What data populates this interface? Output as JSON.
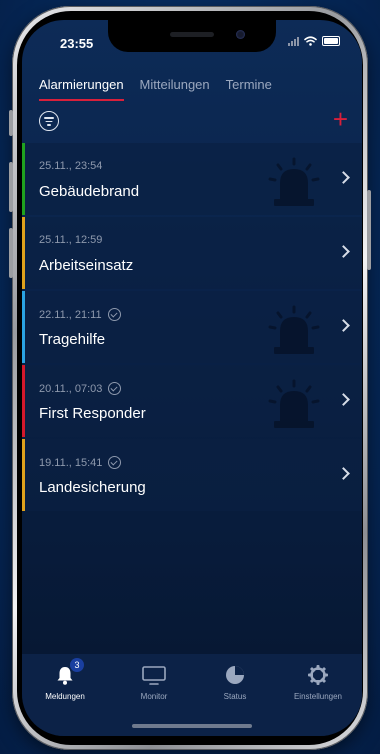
{
  "status_bar": {
    "time": "23:55"
  },
  "tabs": [
    {
      "label": "Alarmierungen",
      "active": true
    },
    {
      "label": "Mitteilungen",
      "active": false
    },
    {
      "label": "Termine",
      "active": false
    }
  ],
  "toolbar": {
    "filter_icon": "filter-icon",
    "add_icon": "plus-icon",
    "add_label": "+"
  },
  "alarms": [
    {
      "datetime": "25.11., 23:54",
      "title": "Gebäudebrand",
      "color": "#1fa31f",
      "acknowledged": false,
      "siren": true
    },
    {
      "datetime": "25.11., 12:59",
      "title": "Arbeitseinsatz",
      "color": "#e0a21c",
      "acknowledged": false,
      "siren": false
    },
    {
      "datetime": "22.11., 21:11",
      "title": "Tragehilfe",
      "color": "#2aa3e3",
      "acknowledged": true,
      "siren": true
    },
    {
      "datetime": "20.11., 07:03",
      "title": "First Responder",
      "color": "#d4182c",
      "acknowledged": true,
      "siren": true
    },
    {
      "datetime": "19.11., 15:41",
      "title": "Landesicherung",
      "color": "#e0a21c",
      "acknowledged": true,
      "siren": false
    }
  ],
  "tabbar": {
    "items": [
      {
        "label": "Meldungen",
        "icon": "bell-icon",
        "badge": "3",
        "active": true
      },
      {
        "label": "Monitor",
        "icon": "monitor-icon",
        "active": false
      },
      {
        "label": "Status",
        "icon": "pie-clock-icon",
        "active": false
      },
      {
        "label": "Einstellungen",
        "icon": "gear-icon",
        "active": false
      }
    ]
  },
  "colors": {
    "accent": "#d8203b",
    "background": "#0a234a"
  }
}
